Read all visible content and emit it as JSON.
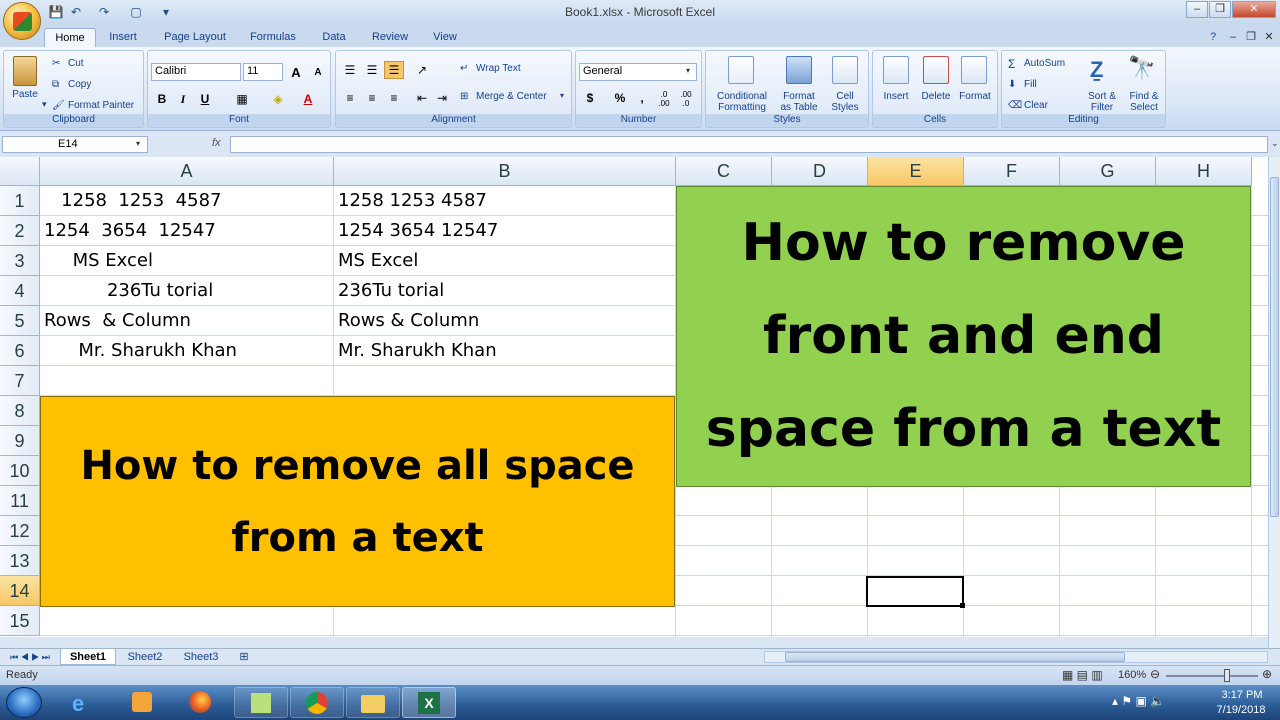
{
  "window": {
    "title": "Book1.xlsx - Microsoft Excel",
    "controls": [
      "–",
      "❐",
      "✕"
    ],
    "help_icon": "?"
  },
  "tabs": [
    "Home",
    "Insert",
    "Page Layout",
    "Formulas",
    "Data",
    "Review",
    "View"
  ],
  "ribbon": {
    "clipboard": {
      "label": "Clipboard",
      "paste": "Paste",
      "cut": "Cut",
      "copy": "Copy",
      "format_painter": "Format Painter"
    },
    "font": {
      "label": "Font",
      "name": "Calibri",
      "size": "11",
      "bold": "B",
      "italic": "I",
      "underline": "U",
      "grow": "A",
      "shrink": "A"
    },
    "alignment": {
      "label": "Alignment",
      "wrap_text": "Wrap Text",
      "merge_center": "Merge & Center"
    },
    "number": {
      "label": "Number",
      "format": "General",
      "currency": "$",
      "percent": "%",
      "comma": ",",
      "inc_decimal": ".0 .00",
      "dec_decimal": ".00 .0"
    },
    "styles": {
      "label": "Styles",
      "conditional": [
        "Conditional",
        "Formatting"
      ],
      "format_table": [
        "Format",
        "as Table"
      ],
      "cell_styles": [
        "Cell",
        "Styles"
      ]
    },
    "cells": {
      "label": "Cells",
      "insert": "Insert",
      "delete": "Delete",
      "format": "Format"
    },
    "editing": {
      "label": "Editing",
      "autosum": "AutoSum",
      "fill": "Fill",
      "clear": "Clear",
      "sort": [
        "Sort &",
        "Filter"
      ],
      "find": [
        "Find &",
        "Select"
      ]
    }
  },
  "formula_bar": {
    "name_box": "E14",
    "fx": "fx",
    "value": ""
  },
  "columns": [
    "A",
    "B",
    "C",
    "D",
    "E",
    "F",
    "G",
    "H"
  ],
  "rows": [
    "1",
    "2",
    "3",
    "4",
    "5",
    "6",
    "7",
    "8",
    "9",
    "10",
    "11",
    "12",
    "13",
    "14",
    "15"
  ],
  "cells": {
    "A1": "   1258  1253  4587",
    "A2": "1254  3654  12547",
    "A3": "     MS Excel",
    "A4": "           236Tu torial",
    "A5": "Rows  & Column",
    "A6": "      Mr. Sharukh Khan",
    "B1": "1258 1253 4587",
    "B2": "1254 3654 12547",
    "B3": "MS Excel",
    "B4": "236Tu torial",
    "B5": "Rows & Column",
    "B6": "Mr. Sharukh Khan"
  },
  "banners": {
    "left": [
      "How to remove all space",
      "from a text"
    ],
    "right": [
      "How to remove",
      "front and end",
      "space from a text"
    ],
    "left_color": "#ffc000",
    "right_color": "#92d050"
  },
  "sheets": [
    "Sheet1",
    "Sheet2",
    "Sheet3"
  ],
  "active_sheet": "Sheet1",
  "status": {
    "ready": "Ready",
    "zoom": "160%"
  },
  "clock": {
    "time": "3:17 PM",
    "date": "7/19/2018"
  }
}
